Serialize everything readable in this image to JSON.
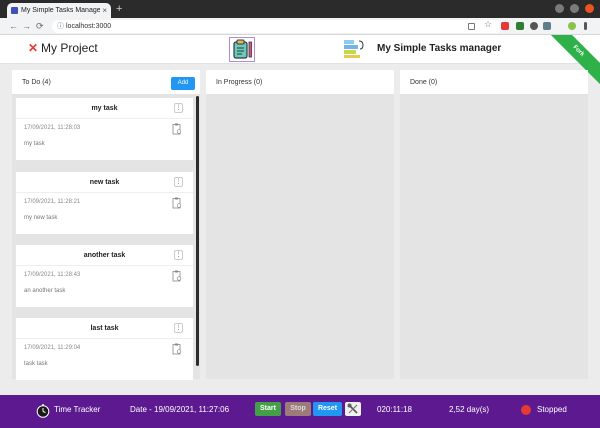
{
  "browser": {
    "tab_title": "My Simple Tasks Manager",
    "tab_close": "×",
    "new_tab": "+",
    "back": "←",
    "forward": "→",
    "reload": "⟳",
    "url": "localhost:3000"
  },
  "app": {
    "project_name": "My Project",
    "title": "My Simple Tasks manager",
    "ribbon_text": "Fork"
  },
  "columns": [
    {
      "title": "To Do (4)",
      "add_label": "Add"
    },
    {
      "title": "In Progress (0)"
    },
    {
      "title": "Done (0)"
    }
  ],
  "tasks": [
    {
      "title": "my task",
      "date": "17/09/2021, 11:28:03",
      "description": "my task"
    },
    {
      "title": "new task",
      "date": "17/09/2021, 11:28:21",
      "description": "my new task"
    },
    {
      "title": "another task",
      "date": "17/09/2021, 11:28:43",
      "description": "an another task"
    },
    {
      "title": "last task",
      "date": "17/09/2021, 11:29:04",
      "description": "task task"
    }
  ],
  "tracker": {
    "label": "Time Tracker",
    "date": "Date - 19/09/2021, 11:27:06",
    "start_label": "Start",
    "stop_label": "Stop",
    "reset_label": "Reset",
    "elapsed": "020:11:18",
    "days": "2,52 day(s)",
    "status": "Stopped",
    "status_color": "#e53935"
  },
  "colors": {
    "accent": "#2196f3",
    "footer": "#5d1a90",
    "start": "#43a047",
    "ribbon": "#2fb14a"
  }
}
